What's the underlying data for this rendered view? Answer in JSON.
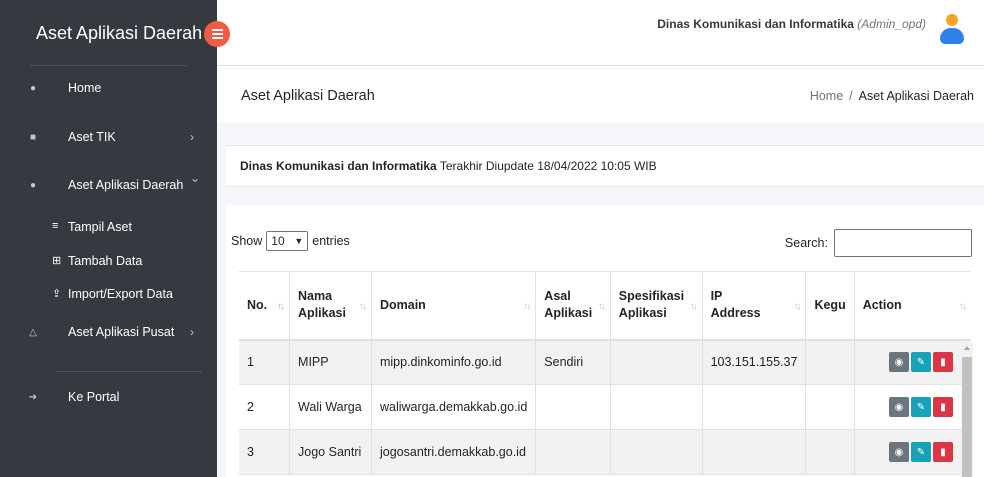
{
  "sidebar": {
    "brand": "Aset Aplikasi Daerah",
    "items": [
      {
        "label": "Home",
        "icon": "tachometer-icon"
      },
      {
        "label": "Aset TIK",
        "icon": "briefcase-icon",
        "chevron": "›"
      },
      {
        "label": "Aset Aplikasi Daerah",
        "icon": "android-icon",
        "chevron": "⌄"
      },
      {
        "label": "Aset Aplikasi Pusat",
        "icon": "flask-icon",
        "chevron": "›"
      },
      {
        "label": "Ke Portal",
        "icon": "sign-in-icon"
      }
    ],
    "sub_items": [
      {
        "label": "Tampil Aset",
        "icon": "list-icon"
      },
      {
        "label": "Tambah Data",
        "icon": "plus-square-icon"
      },
      {
        "label": "Import/Export Data",
        "icon": "upload-icon"
      }
    ]
  },
  "topbar": {
    "org": "Dinas Komunikasi dan Informatika",
    "role": "(Admin_opd)"
  },
  "header": {
    "title": "Aset Aplikasi Daerah",
    "breadcrumb_home": "Home",
    "breadcrumb_sep": "/",
    "breadcrumb_current": "Aset Aplikasi Daerah"
  },
  "info": {
    "org": "Dinas Komunikasi dan Informatika",
    "updated": "Terakhir Diupdate 18/04/2022 10:05 WIB"
  },
  "table": {
    "show_label": "Show",
    "length_value": "10",
    "entries_label": "entries",
    "search_label": "Search:",
    "columns": [
      "No.",
      "Nama Aplikasi",
      "Domain",
      "Asal Aplikasi",
      "Spesifikasi Aplikasi",
      "IP Address",
      "Kegu",
      "Action"
    ],
    "rows": [
      [
        "1",
        "MIPP",
        "mipp.dinkominfo.go.id",
        "Sendiri",
        "",
        "103.151.155.37",
        ""
      ],
      [
        "2",
        "Wali Warga",
        "waliwarga.demakkab.go.id",
        "",
        "",
        "",
        ""
      ],
      [
        "3",
        "Jogo Santri",
        "jogosantri.demakkab.go.id",
        "",
        "",
        "",
        ""
      ]
    ]
  },
  "colors": {
    "sidebar": "#343a40",
    "toggle": "#ee5c44",
    "view": "#6c757d",
    "edit": "#17a2b8",
    "delete": "#dc3545"
  }
}
